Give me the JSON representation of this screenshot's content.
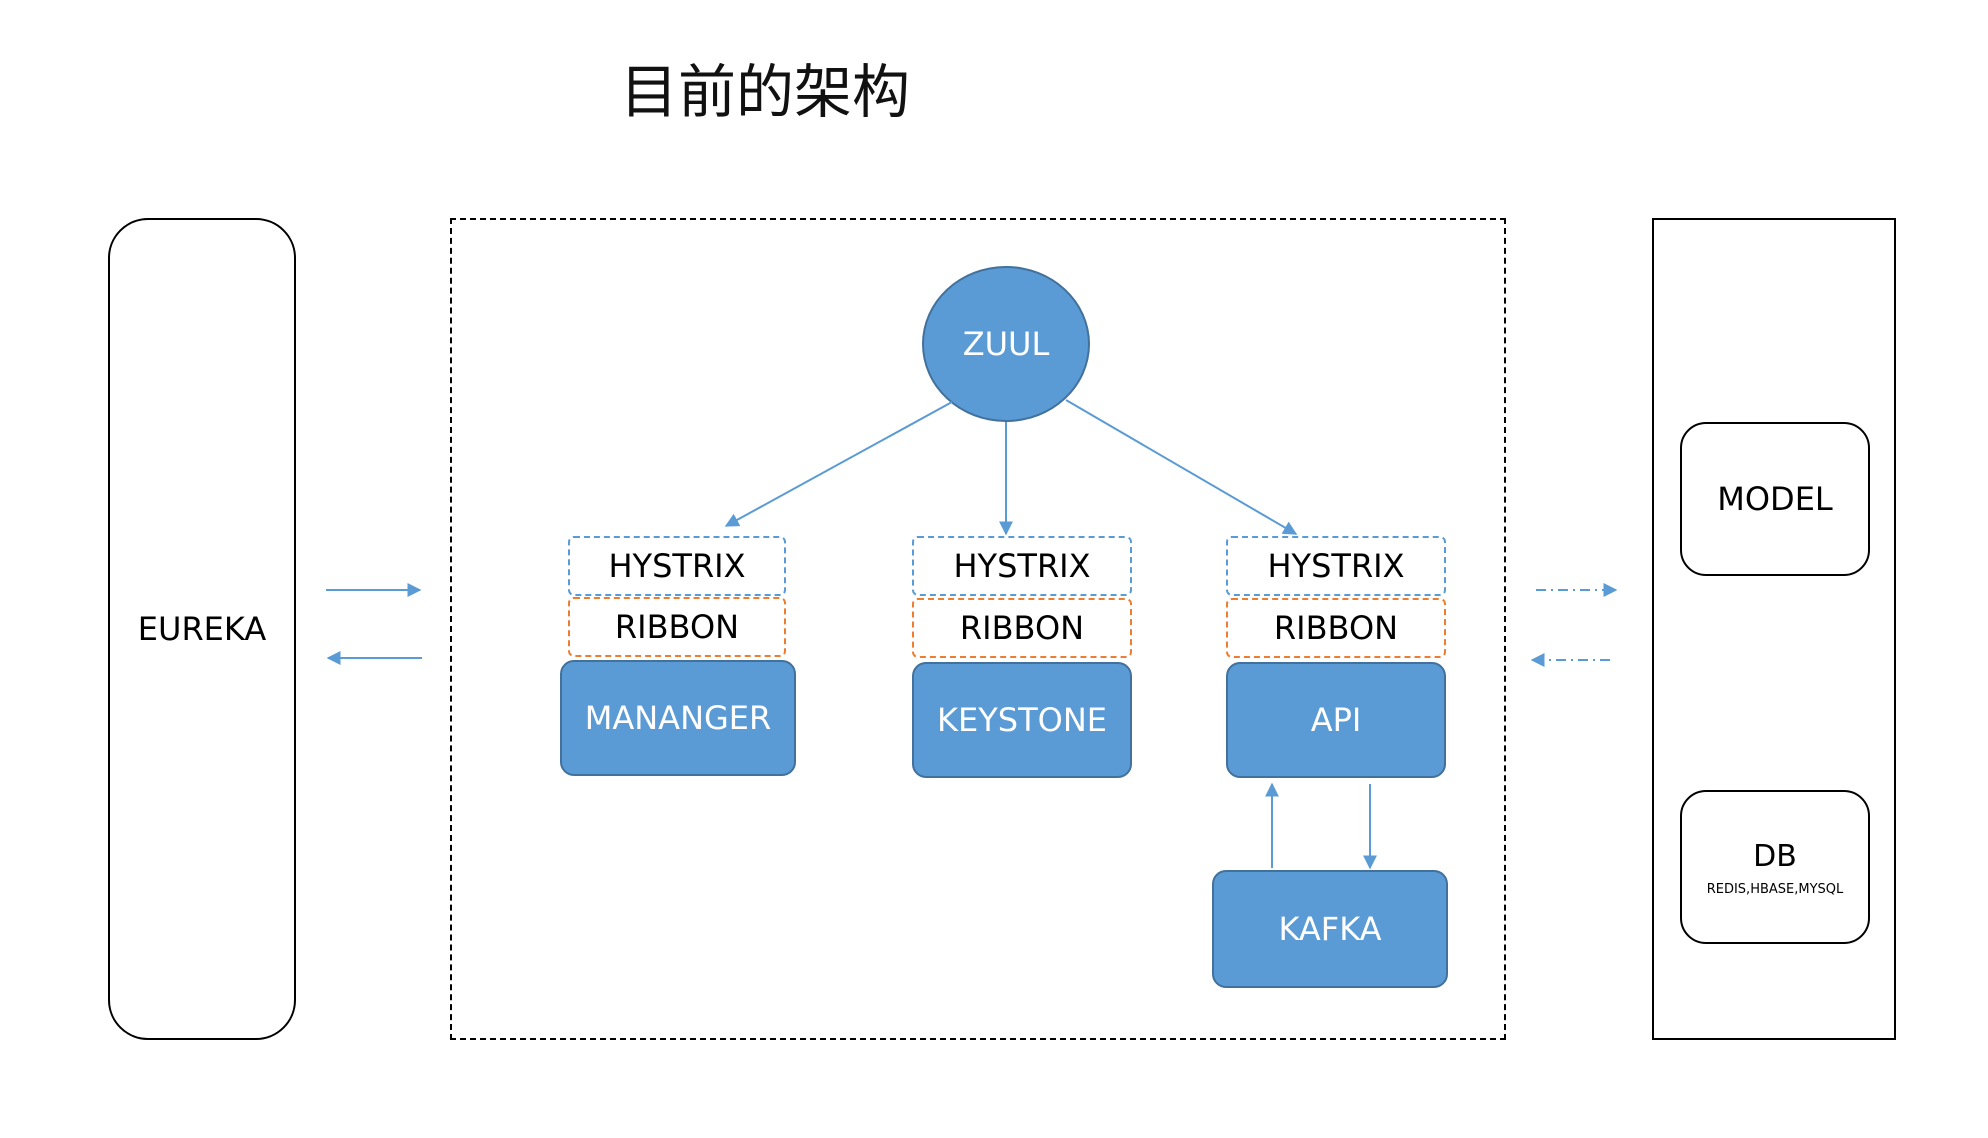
{
  "title": "目前的架构",
  "eureka": {
    "label": "EUREKA"
  },
  "zuul": {
    "label": "ZUUL"
  },
  "services": [
    {
      "hystrix": "HYSTRIX",
      "ribbon": "RIBBON",
      "name": "MANANGER"
    },
    {
      "hystrix": "HYSTRIX",
      "ribbon": "RIBBON",
      "name": "KEYSTONE"
    },
    {
      "hystrix": "HYSTRIX",
      "ribbon": "RIBBON",
      "name": "API"
    }
  ],
  "kafka": {
    "label": "KAFKA"
  },
  "model": {
    "label": "MODEL"
  },
  "db": {
    "label": "DB",
    "sublabel": "REDIS,HBASE,MYSQL"
  },
  "colors": {
    "node_fill": "#5b9bd5",
    "node_border": "#41719c",
    "hystrix_border": "#5b9bd5",
    "ribbon_border": "#ed7d31",
    "arrow": "#5b9bd5"
  }
}
